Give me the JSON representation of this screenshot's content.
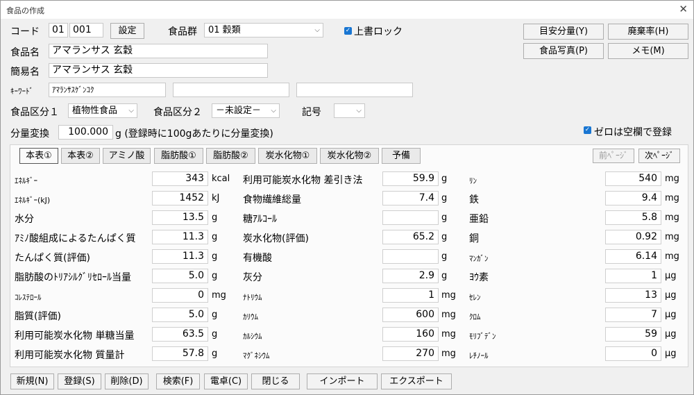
{
  "window": {
    "title": "食品の作成"
  },
  "header": {
    "code_label": "コード",
    "code1": "01",
    "code2": "001",
    "set_button": "設定",
    "group_label": "食品群",
    "group_value": "01 穀類",
    "overwrite_lock_label": "上書ロック",
    "name_label": "食品名",
    "name_value": "アマランサス 玄穀",
    "short_name_label": "簡易名",
    "short_name_value": "アマランサス 玄穀",
    "keyword_label": "ｷｰﾜｰﾄﾞ",
    "keyword1": "ｱﾏﾗﾝｻｽｹﾞﾝｺｸ",
    "keyword2": "",
    "keyword3": "",
    "category1_label": "食品区分１",
    "category1_value": "植物性食品",
    "category2_label": "食品区分２",
    "category2_value": "－未設定－",
    "symbol_label": "記号",
    "symbol_value": "",
    "amount_label": "分量変換",
    "amount_value": "100.000",
    "amount_unit": "g (登録時に100gあたりに分量変換)",
    "zero_blank_label": "ゼロは空欄で登録"
  },
  "side_buttons": {
    "serving": "目安分量(Y)",
    "waste": "廃棄率(H)",
    "photo": "食品写真(P)",
    "memo": "メモ(M)"
  },
  "tabs": [
    "本表①",
    "本表②",
    "アミノ酸",
    "脂肪酸①",
    "脂肪酸②",
    "炭水化物①",
    "炭水化物②",
    "予備"
  ],
  "page_nav": {
    "prev": "前ﾍﾟｰｼﾞ",
    "next": "次ﾍﾟｰｼﾞ"
  },
  "col1": [
    {
      "label": "ｴﾈﾙｷﾞｰ",
      "value": "343",
      "unit": "kcal"
    },
    {
      "label": "ｴﾈﾙｷﾞｰ(kJ)",
      "value": "1452",
      "unit": "kJ"
    },
    {
      "label": "水分",
      "value": "13.5",
      "unit": "g"
    },
    {
      "label": "ｱﾐﾉ酸組成によるたんぱく質",
      "value": "11.3",
      "unit": "g"
    },
    {
      "label": "たんぱく質(評価)",
      "value": "11.3",
      "unit": "g"
    },
    {
      "label": "脂肪酸のﾄﾘｱｼﾙｸﾞﾘｾﾛｰﾙ当量",
      "value": "5.0",
      "unit": "g"
    },
    {
      "label": "ｺﾚｽﾃﾛｰﾙ",
      "value": "0",
      "unit": "mg"
    },
    {
      "label": "脂質(評価)",
      "value": "5.0",
      "unit": "g"
    },
    {
      "label": "利用可能炭水化物 単糖当量",
      "value": "63.5",
      "unit": "g"
    },
    {
      "label": "利用可能炭水化物 質量計",
      "value": "57.8",
      "unit": "g"
    }
  ],
  "col2": [
    {
      "label": "利用可能炭水化物 差引き法",
      "value": "59.9",
      "unit": "g"
    },
    {
      "label": "食物繊維総量",
      "value": "7.4",
      "unit": "g"
    },
    {
      "label": "糖ｱﾙｺｰﾙ",
      "value": "",
      "unit": "g"
    },
    {
      "label": "炭水化物(評価)",
      "value": "65.2",
      "unit": "g"
    },
    {
      "label": "有機酸",
      "value": "",
      "unit": "g"
    },
    {
      "label": "灰分",
      "value": "2.9",
      "unit": "g"
    },
    {
      "label": "ﾅﾄﾘｳﾑ",
      "value": "1",
      "unit": "mg"
    },
    {
      "label": "ｶﾘｳﾑ",
      "value": "600",
      "unit": "mg"
    },
    {
      "label": "ｶﾙｼｳﾑ",
      "value": "160",
      "unit": "mg"
    },
    {
      "label": "ﾏｸﾞﾈｼｳﾑ",
      "value": "270",
      "unit": "mg"
    }
  ],
  "col3": [
    {
      "label": "ﾘﾝ",
      "value": "540",
      "unit": "mg"
    },
    {
      "label": "鉄",
      "value": "9.4",
      "unit": "mg"
    },
    {
      "label": "亜鉛",
      "value": "5.8",
      "unit": "mg"
    },
    {
      "label": "銅",
      "value": "0.92",
      "unit": "mg"
    },
    {
      "label": "ﾏﾝｶﾞﾝ",
      "value": "6.14",
      "unit": "mg"
    },
    {
      "label": "ﾖｳ素",
      "value": "1",
      "unit": "μg"
    },
    {
      "label": "ｾﾚﾝ",
      "value": "13",
      "unit": "μg"
    },
    {
      "label": "ｸﾛﾑ",
      "value": "7",
      "unit": "μg"
    },
    {
      "label": "ﾓﾘﾌﾞﾃﾞﾝ",
      "value": "59",
      "unit": "μg"
    },
    {
      "label": "ﾚﾁﾉｰﾙ",
      "value": "0",
      "unit": "μg"
    }
  ],
  "footer": [
    "新規(N)",
    "登録(S)",
    "削除(D)",
    "検索(F)",
    "電卓(C)",
    "閉じる",
    "インポート",
    "エクスポート"
  ],
  "colors": {
    "checkbox": "#1976d2"
  }
}
